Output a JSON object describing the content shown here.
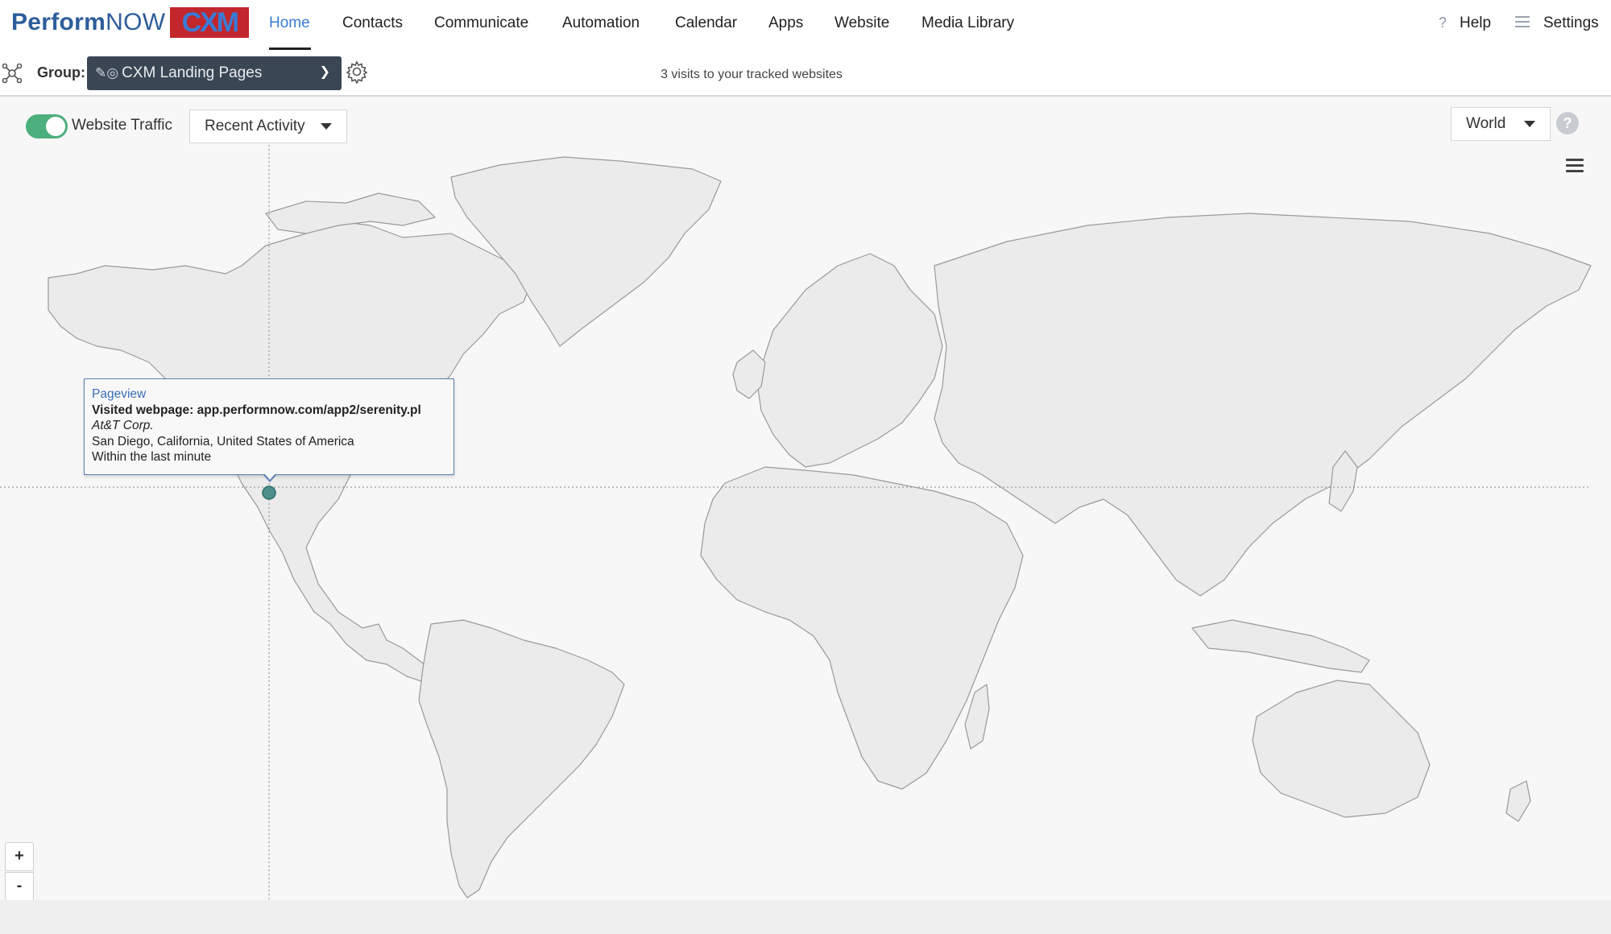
{
  "brand": {
    "logo_text_1": "Perform",
    "logo_text_2": "NOW",
    "logo_badge": "CXM"
  },
  "nav": {
    "items": [
      "Home",
      "Contacts",
      "Communicate",
      "Automation",
      "Calendar",
      "Apps",
      "Website",
      "Media Library"
    ],
    "active": "Home",
    "help_label": "Help",
    "settings_label": "Settings"
  },
  "group": {
    "label": "Group:",
    "selected": "CXM Landing Pages"
  },
  "visits_text": "3 visits to your tracked websites",
  "toolbar": {
    "traffic_toggle_on": true,
    "traffic_label": "Website Traffic",
    "activity_select": "Recent Activity",
    "region_select": "World",
    "help_icon": "?"
  },
  "map": {
    "zoom_in": "+",
    "zoom_out": "-",
    "marker_color": "#4d8f8a",
    "land_color": "#ebebeb",
    "border_color": "#9a9a9a"
  },
  "tooltip": {
    "type": "Pageview",
    "page": "Visited webpage: app.performnow.com/app2/serenity.pl",
    "org": "At&T Corp.",
    "location": "San Diego, California, United States of America",
    "time": "Within the last minute"
  },
  "colors": {
    "accent": "#3a7bd5",
    "toggle_on": "#4caf7d",
    "group_bg": "#3b4654"
  }
}
